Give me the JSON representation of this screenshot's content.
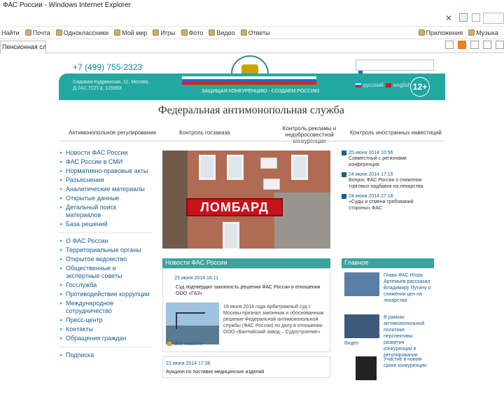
{
  "browser": {
    "window_title": "ФАС России - Windows Internet Explorer",
    "links_bar": [
      "Почта",
      "Одноклассники",
      "Мой мир",
      "Игры",
      "Фото",
      "Видео",
      "Ответы"
    ],
    "links_bar_left": "Найти",
    "links_bar_right": [
      "Приложения",
      "Музыка"
    ],
    "tab_label": "Пенсионная служ..."
  },
  "header": {
    "phone": "+7 (499) 755-2323",
    "address": "Садовая-Кудринская, 11, Москва, Д-242, ГСП-3, 125993",
    "caption": "ЗАЩИЩАЯ КОНКУРЕНЦИЮ - СОЗДАЕМ РОССИЮ",
    "lang_ru": "русский",
    "lang_en": "english",
    "age": "12+",
    "site_name": "Федеральная антимонопольная служба"
  },
  "nav": [
    "Антимонопольное регулирование",
    "Контроль госзаказа",
    "Контроль рекламы и недобросовестной конкуренции",
    "Контроль иностранных инвестиций"
  ],
  "left_menu_1": [
    "Новости ФАС России",
    "ФАС России в СМИ",
    "Нормативно-правовые акты",
    "Разъяснения",
    "Аналитические материалы",
    "Открытые данные",
    "Детальный поиск материалов",
    "База решений"
  ],
  "left_menu_2": [
    "О ФАС России",
    "Территориальные органы",
    "Открытое ведомство",
    "Общественные и экспертные советы",
    "Госслужба",
    "Противодействие коррупции",
    "Международное сотрудничество",
    "Пресс-центр",
    "Контакты",
    "Обращения граждан"
  ],
  "left_bottom": "Подписка",
  "photo_sign": "ЛОМБАРД",
  "news": {
    "header": "Новости ФАС России",
    "date1": "23 июня 2014 18:11",
    "title1": "Суд подтвердил законность решения ФАС России в отношении ООО «ГАЗ»",
    "body": "19 июня 2014 года Арбитражный суд г. Москвы признал законным и обоснованным решение Федеральной антимонопольной службы (ФАС России) по делу в отношении ООО «Балтийский завод – Судостроение»",
    "more": "Все новости",
    "date2": "23 июня 2014 17:36",
    "title2": "Аукцион по поставке медицинских изделий"
  },
  "right_news": [
    {
      "date": "25 июня 2014 10:56",
      "text": "Совместный с регионами конференция"
    },
    {
      "date": "24 июня 2014 17:15",
      "text": "Вопрос ФАС России о снижении торговых надбавок на лекарства"
    },
    {
      "date": "24 июня 2014 17:18",
      "text": "«Суды и отмена требований стороны» ФАС"
    }
  ],
  "main": {
    "header": "Главное",
    "items": [
      {
        "text": "Глава ФАС Игорь Артемьев рассказал Владимиру Путину о снижении цен на лекарства",
        "link": ""
      },
      {
        "text": "В рамках антимонопольной политики перспективы развития конкуренции в регулировании",
        "link": "Видео"
      },
      {
        "text": "Участие в новом сроке конкуренции",
        "link": ""
      }
    ]
  },
  "colors": {
    "brand": "#22a8a0",
    "link": "#1a5e90",
    "sign": "#c8121c"
  }
}
